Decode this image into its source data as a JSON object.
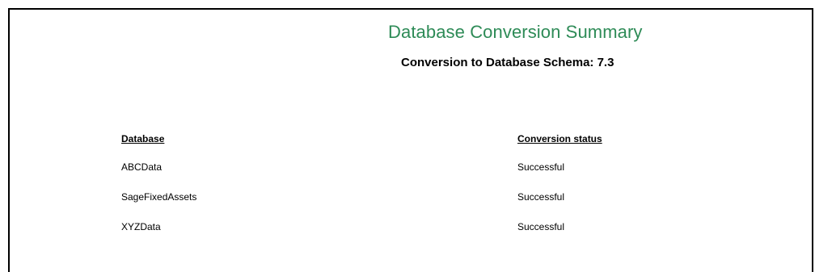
{
  "report": {
    "title": "Database Conversion Summary",
    "subtitle": "Conversion to Database Schema: 7.3"
  },
  "table": {
    "headers": [
      "Database",
      "Conversion status"
    ],
    "rows": [
      {
        "database": "ABCData",
        "status": "Successful"
      },
      {
        "database": "SageFixedAssets",
        "status": "Successful"
      },
      {
        "database": "XYZData",
        "status": "Successful"
      }
    ]
  },
  "colors": {
    "title": "#2e8b57",
    "text": "#000000",
    "border": "#000000"
  }
}
